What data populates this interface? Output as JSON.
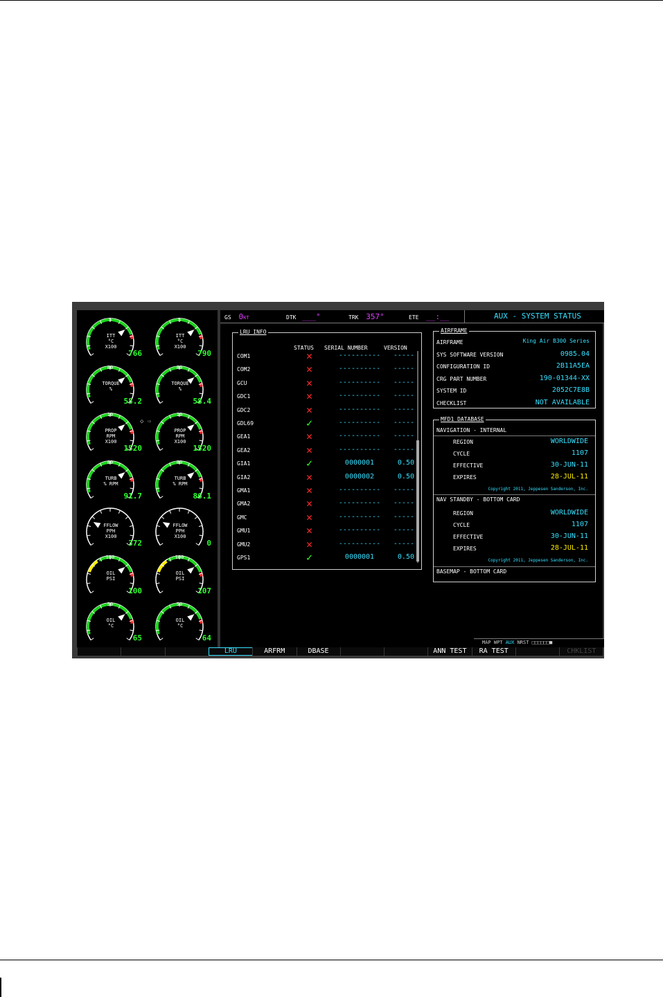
{
  "navbar": {
    "gs_label": "GS",
    "gs_value": "0",
    "gs_unit": "KT",
    "dtk_label": "DTK",
    "dtk_value": "___°",
    "trk_label": "TRK",
    "trk_value": "357°",
    "ete_label": "ETE",
    "ete_value": "__:__",
    "page_title": "AUX - SYSTEM STATUS"
  },
  "eis": {
    "gauges": [
      {
        "label1": "ITT",
        "label2": "°C",
        "label3": "X100",
        "scale": "5",
        "value": "766"
      },
      {
        "label1": "ITT",
        "label2": "°C",
        "label3": "X100",
        "scale": "5",
        "value": "790"
      },
      {
        "label1": "TORQUE",
        "label2": "%",
        "label3": "",
        "scale": "80",
        "value": "58.2"
      },
      {
        "label1": "TORQUE",
        "label2": "%",
        "label3": "",
        "scale": "80",
        "value": "58.4"
      },
      {
        "label1": "PROP",
        "label2": "RPM",
        "label3": "X100",
        "scale": "10",
        "value": "1520"
      },
      {
        "label1": "PROP",
        "label2": "RPM",
        "label3": "X100",
        "scale": "10",
        "value": "1520"
      },
      {
        "label1": "TURB",
        "label2": "% RPM",
        "label3": "",
        "scale": "80",
        "value": "91.7"
      },
      {
        "label1": "TURB",
        "label2": "% RPM",
        "label3": "",
        "scale": "80",
        "value": "86.1"
      },
      {
        "label1": "FFLOW",
        "label2": "PPH",
        "label3": "X100",
        "scale": "",
        "value": "372"
      },
      {
        "label1": "FFLOW",
        "label2": "PPH",
        "label3": "X100",
        "scale": "",
        "value": "0"
      },
      {
        "label1": "OIL",
        "label2": "PSI",
        "label3": "",
        "scale": "100",
        "value": "100"
      },
      {
        "label1": "OIL",
        "label2": "PSI",
        "label3": "",
        "scale": "100",
        "value": "107"
      },
      {
        "label1": "OIL",
        "label2": "°C",
        "label3": "",
        "scale": "50",
        "value": "65"
      },
      {
        "label1": "OIL",
        "label2": "°C",
        "label3": "",
        "scale": "50",
        "value": "64"
      }
    ]
  },
  "lru_info": {
    "title": "LRU INFO",
    "headers": {
      "status": "STATUS",
      "serial": "SERIAL NUMBER",
      "version": "VERSION"
    },
    "rows": [
      {
        "name": "COM1",
        "status": "fail",
        "serial": "----------",
        "version": "-----"
      },
      {
        "name": "COM2",
        "status": "fail",
        "serial": "----------",
        "version": "-----"
      },
      {
        "name": "GCU",
        "status": "fail",
        "serial": "----------",
        "version": "-----"
      },
      {
        "name": "GDC1",
        "status": "fail",
        "serial": "----------",
        "version": "-----"
      },
      {
        "name": "GDC2",
        "status": "fail",
        "serial": "----------",
        "version": "-----"
      },
      {
        "name": "GDL69",
        "status": "ok",
        "serial": "----------",
        "version": "-----"
      },
      {
        "name": "GEA1",
        "status": "fail",
        "serial": "----------",
        "version": "-----"
      },
      {
        "name": "GEA2",
        "status": "fail",
        "serial": "----------",
        "version": "-----"
      },
      {
        "name": "GIA1",
        "status": "ok",
        "serial": "0000001",
        "version": "0.50"
      },
      {
        "name": "GIA2",
        "status": "fail",
        "serial": "0000002",
        "version": "0.50"
      },
      {
        "name": "GMA1",
        "status": "fail",
        "serial": "----------",
        "version": "-----"
      },
      {
        "name": "GMA2",
        "status": "fail",
        "serial": "----------",
        "version": "-----"
      },
      {
        "name": "GMC",
        "status": "fail",
        "serial": "----------",
        "version": "-----"
      },
      {
        "name": "GMU1",
        "status": "fail",
        "serial": "----------",
        "version": "-----"
      },
      {
        "name": "GMU2",
        "status": "fail",
        "serial": "----------",
        "version": "-----"
      },
      {
        "name": "GPS1",
        "status": "ok",
        "serial": "0000001",
        "version": "0.50"
      }
    ]
  },
  "airframe": {
    "title": "AIRFRAME",
    "rows": [
      {
        "label": "AIRFRAME",
        "value": "King Air B300 Series"
      },
      {
        "label": "SYS SOFTWARE VERSION",
        "value": "0985.04"
      },
      {
        "label": "CONFIGURATION ID",
        "value": "2B11A5EA"
      },
      {
        "label": "CRG PART NUMBER",
        "value": "190-01344-XX"
      },
      {
        "label": "SYSTEM ID",
        "value": "2052C7E8B"
      },
      {
        "label": "CHECKLIST",
        "value": "NOT AVAILABLE"
      }
    ]
  },
  "mfd_db": {
    "title": "MFD1 DATABASE",
    "nav_internal": "NAVIGATION - INTERNAL",
    "nav_standby": "NAV STANDBY - BOTTOM CARD",
    "basemap": "BASEMAP - BOTTOM CARD",
    "region_label": "REGION",
    "region_value": "WORLDWIDE",
    "cycle_label": "CYCLE",
    "cycle_value": "1107",
    "effective_label": "EFFECTIVE",
    "effective_value": "30-JUN-11",
    "expires_label": "EXPIRES",
    "expires_value": "28-JUL-11",
    "copyright": "Copyright 2011, Jeppesen Sanderson, Inc.",
    "region2_value": "WORLDWIDE",
    "cycle2_value": "1107",
    "effective2_value": "30-JUN-11",
    "expires2_value": "28-JUL-11",
    "copyright2": "Copyright 2011, Jeppesen Sanderson, Inc."
  },
  "statusbar": {
    "prefix": "MAP WPT ",
    "aux": "AUX",
    "suffix": " NRST □□□□□□■"
  },
  "softkeys": [
    "",
    "",
    "",
    "LRU",
    "ARFRM",
    "DBASE",
    "",
    "",
    "ANN TEST",
    "RA TEST",
    "",
    "CHKLIST"
  ],
  "colors": {
    "cyan": "#36e0ff",
    "magenta": "#e040ff",
    "green": "#2dff2d",
    "red": "#ff2a2a",
    "yellow": "#ffee00"
  }
}
